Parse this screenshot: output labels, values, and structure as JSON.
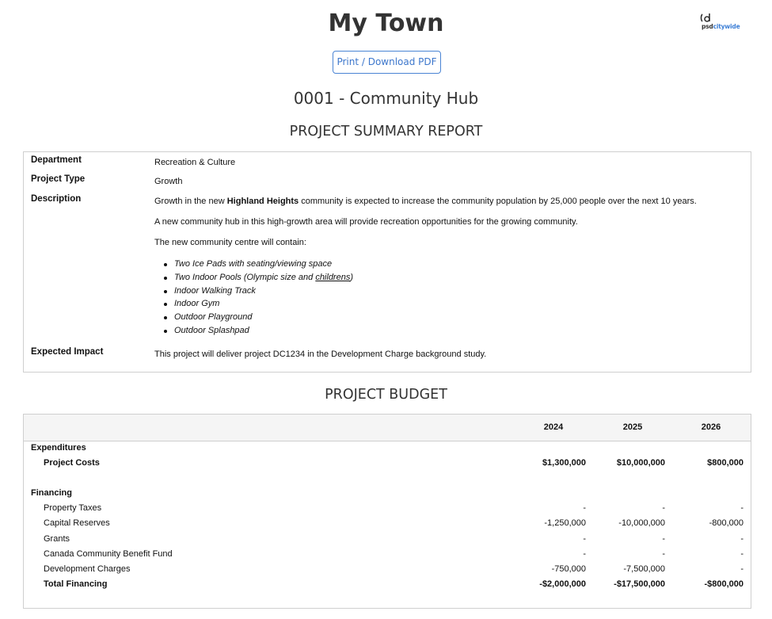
{
  "app": {
    "town_name": "My Town",
    "logo_text_psd": "psd",
    "logo_text_citywide": "citywide",
    "print_button_label": "Print / Download PDF"
  },
  "project": {
    "title": "0001 - Community Hub"
  },
  "summary": {
    "heading": "PROJECT SUMMARY REPORT",
    "department_label": "Department",
    "department_value": "Recreation & Culture",
    "project_type_label": "Project Type",
    "project_type_value": "Growth",
    "description_label": "Description",
    "description_p1_before": "Growth in the new ",
    "description_p1_bold": "Highland Heights",
    "description_p1_after": " community is expected to increase the community population by 25,000 people over the next 10 years.",
    "description_p2": "A new community hub in this high-growth area will provide recreation opportunities for the growing community.",
    "description_p3": "The new community centre will contain:",
    "features": [
      "Two Ice Pads with seating/viewing space",
      "Two Indoor Pools (Olympic size and ",
      "Indoor Walking Track",
      "Indoor Gym",
      "Outdoor Playground",
      "Outdoor Splashpad"
    ],
    "feature_2_underlined": "childrens",
    "feature_2_suffix": ")",
    "expected_impact_label": "Expected Impact",
    "expected_impact_value": "This project will deliver project DC1234 in the Development Charge background study."
  },
  "budget": {
    "heading": "PROJECT BUDGET",
    "years": [
      "2024",
      "2025",
      "2026"
    ],
    "expenditures_label": "Expenditures",
    "project_costs": {
      "label": "Project Costs",
      "values": [
        "$1,300,000",
        "$10,000,000",
        "$800,000"
      ]
    },
    "financing_label": "Financing",
    "financing_rows": [
      {
        "label": "Property Taxes",
        "values": [
          "-",
          "-",
          "-"
        ]
      },
      {
        "label": "Capital Reserves",
        "values": [
          "-1,250,000",
          "-10,000,000",
          "-800,000"
        ]
      },
      {
        "label": "Grants",
        "values": [
          "-",
          "-",
          "-"
        ]
      },
      {
        "label": "Canada Community Benefit Fund",
        "values": [
          "-",
          "-",
          "-"
        ]
      },
      {
        "label": "Development Charges",
        "values": [
          "-750,000",
          "-7,500,000",
          "-"
        ]
      }
    ],
    "total_financing": {
      "label": "Total Financing",
      "values": [
        "-$2,000,000",
        "-$17,500,000",
        "-$800,000"
      ]
    }
  }
}
